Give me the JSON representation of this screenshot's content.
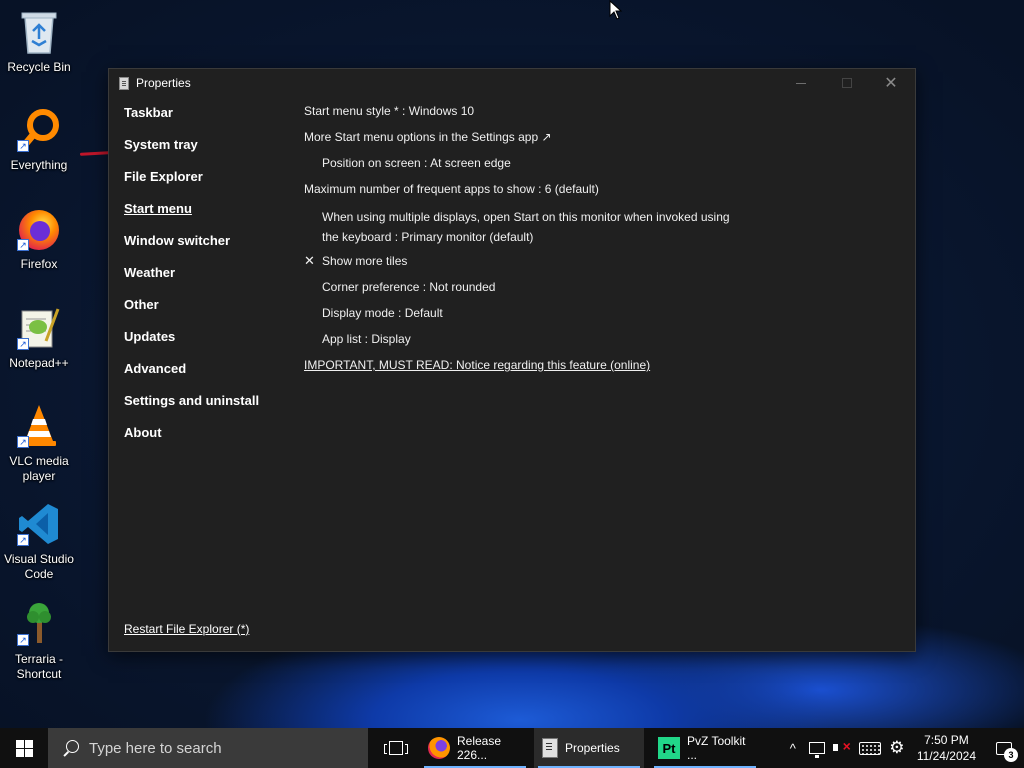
{
  "desktop": {
    "icons": [
      {
        "label": "Recycle Bin",
        "icon": "recycle-bin-icon"
      },
      {
        "label": "Everything",
        "icon": "everything-search-icon"
      },
      {
        "label": "Firefox",
        "icon": "firefox-icon"
      },
      {
        "label": "Notepad++",
        "icon": "notepad-plus-plus-icon"
      },
      {
        "label": "VLC media player",
        "icon": "vlc-icon"
      },
      {
        "label": "Visual Studio Code",
        "icon": "vscode-icon"
      },
      {
        "label": "Terraria - Shortcut",
        "icon": "terraria-icon"
      }
    ]
  },
  "window": {
    "title": "Properties",
    "controls": {
      "minimize": "—",
      "maximize": "☐",
      "close": "✕"
    },
    "sidebar": {
      "items": [
        {
          "label": "Taskbar"
        },
        {
          "label": "System tray"
        },
        {
          "label": "File Explorer"
        },
        {
          "label": "Start menu",
          "active": true
        },
        {
          "label": "Window switcher"
        },
        {
          "label": "Weather"
        },
        {
          "label": "Other"
        },
        {
          "label": "Updates"
        },
        {
          "label": "Advanced"
        },
        {
          "label": "Settings and uninstall"
        },
        {
          "label": "About"
        }
      ],
      "restart_link": "Restart File Explorer (*)"
    },
    "settings": {
      "start_menu_style": "Start menu style * : Windows 10",
      "more_options": "More Start menu options in the Settings app ↗",
      "position": "Position on screen : At screen edge",
      "max_frequent": "Maximum number of frequent apps to show : 6 (default)",
      "multi_display_line1": "When using multiple displays, open Start on this monitor when invoked using",
      "multi_display_line2": "the keyboard : Primary monitor (default)",
      "show_more_tiles": "Show more tiles",
      "show_more_tiles_check": "✕",
      "corner_pref": "Corner preference : Not rounded",
      "display_mode": "Display mode : Default",
      "app_list": "App list : Display",
      "important_link": "IMPORTANT, MUST READ: Notice regarding this feature (online)"
    }
  },
  "taskbar": {
    "search_placeholder": "Type here to search",
    "apps": [
      {
        "label": "Release 226...",
        "icon": "firefox-icon"
      },
      {
        "label": "Properties",
        "icon": "properties-icon",
        "active": true
      },
      {
        "label": "PvZ Toolkit ...",
        "icon": "pycharm-icon",
        "glyph": "Pt"
      }
    ],
    "tray": {
      "chevron": "^",
      "time": "7:50 PM",
      "date": "11/24/2024",
      "notification_count": "3",
      "settings_glyph": "⚙"
    }
  },
  "colors": {
    "window_bg": "#202020",
    "taskbar_bg": "#101010",
    "accent_underline": "#6fb3ff"
  }
}
